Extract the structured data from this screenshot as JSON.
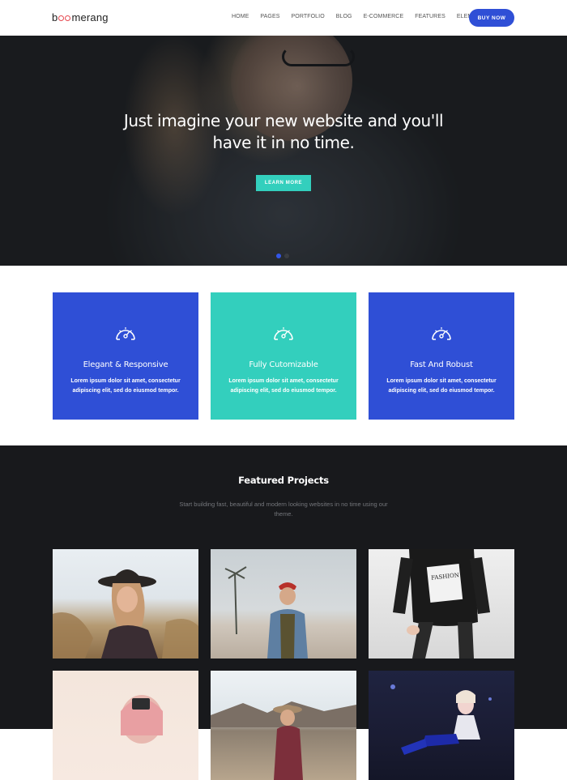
{
  "header": {
    "logo": {
      "prefix": "b",
      "suffix": "merang"
    },
    "nav": [
      "HOME",
      "PAGES",
      "PORTFOLIO",
      "BLOG",
      "E-COMMERCE",
      "FEATURES",
      "ELEMENTS"
    ],
    "cta": "BUY NOW"
  },
  "hero": {
    "title": "Just imagine your new website and you'll have it in no time.",
    "button": "LEARN MORE",
    "slides": 2,
    "active_slide": 1
  },
  "features": [
    {
      "title": "Elegant & Responsive",
      "text": "Lorem ipsum dolor sit amet, consectetur adipiscing elit, sed do eiusmod tempor.",
      "color": "#2f4fd6",
      "icon": "speedometer-icon"
    },
    {
      "title": "Fully Cutomizable",
      "text": "Lorem ipsum dolor sit amet, consectetur adipiscing elit, sed do eiusmod tempor.",
      "color": "#33cfbd",
      "icon": "speedometer-icon"
    },
    {
      "title": "Fast And Robust",
      "text": "Lorem ipsum dolor sit amet, consectetur adipiscing elit, sed do eiusmod tempor.",
      "color": "#2f4fd6",
      "icon": "speedometer-icon"
    }
  ],
  "projects": {
    "title": "Featured Projects",
    "subtitle": "Start building fast, beautiful and modern looking websites in no time using our theme."
  },
  "colors": {
    "accent": "#2f4fd6",
    "teal": "#33cfbd",
    "logo": "#e6484f",
    "dark": "#18191c"
  }
}
